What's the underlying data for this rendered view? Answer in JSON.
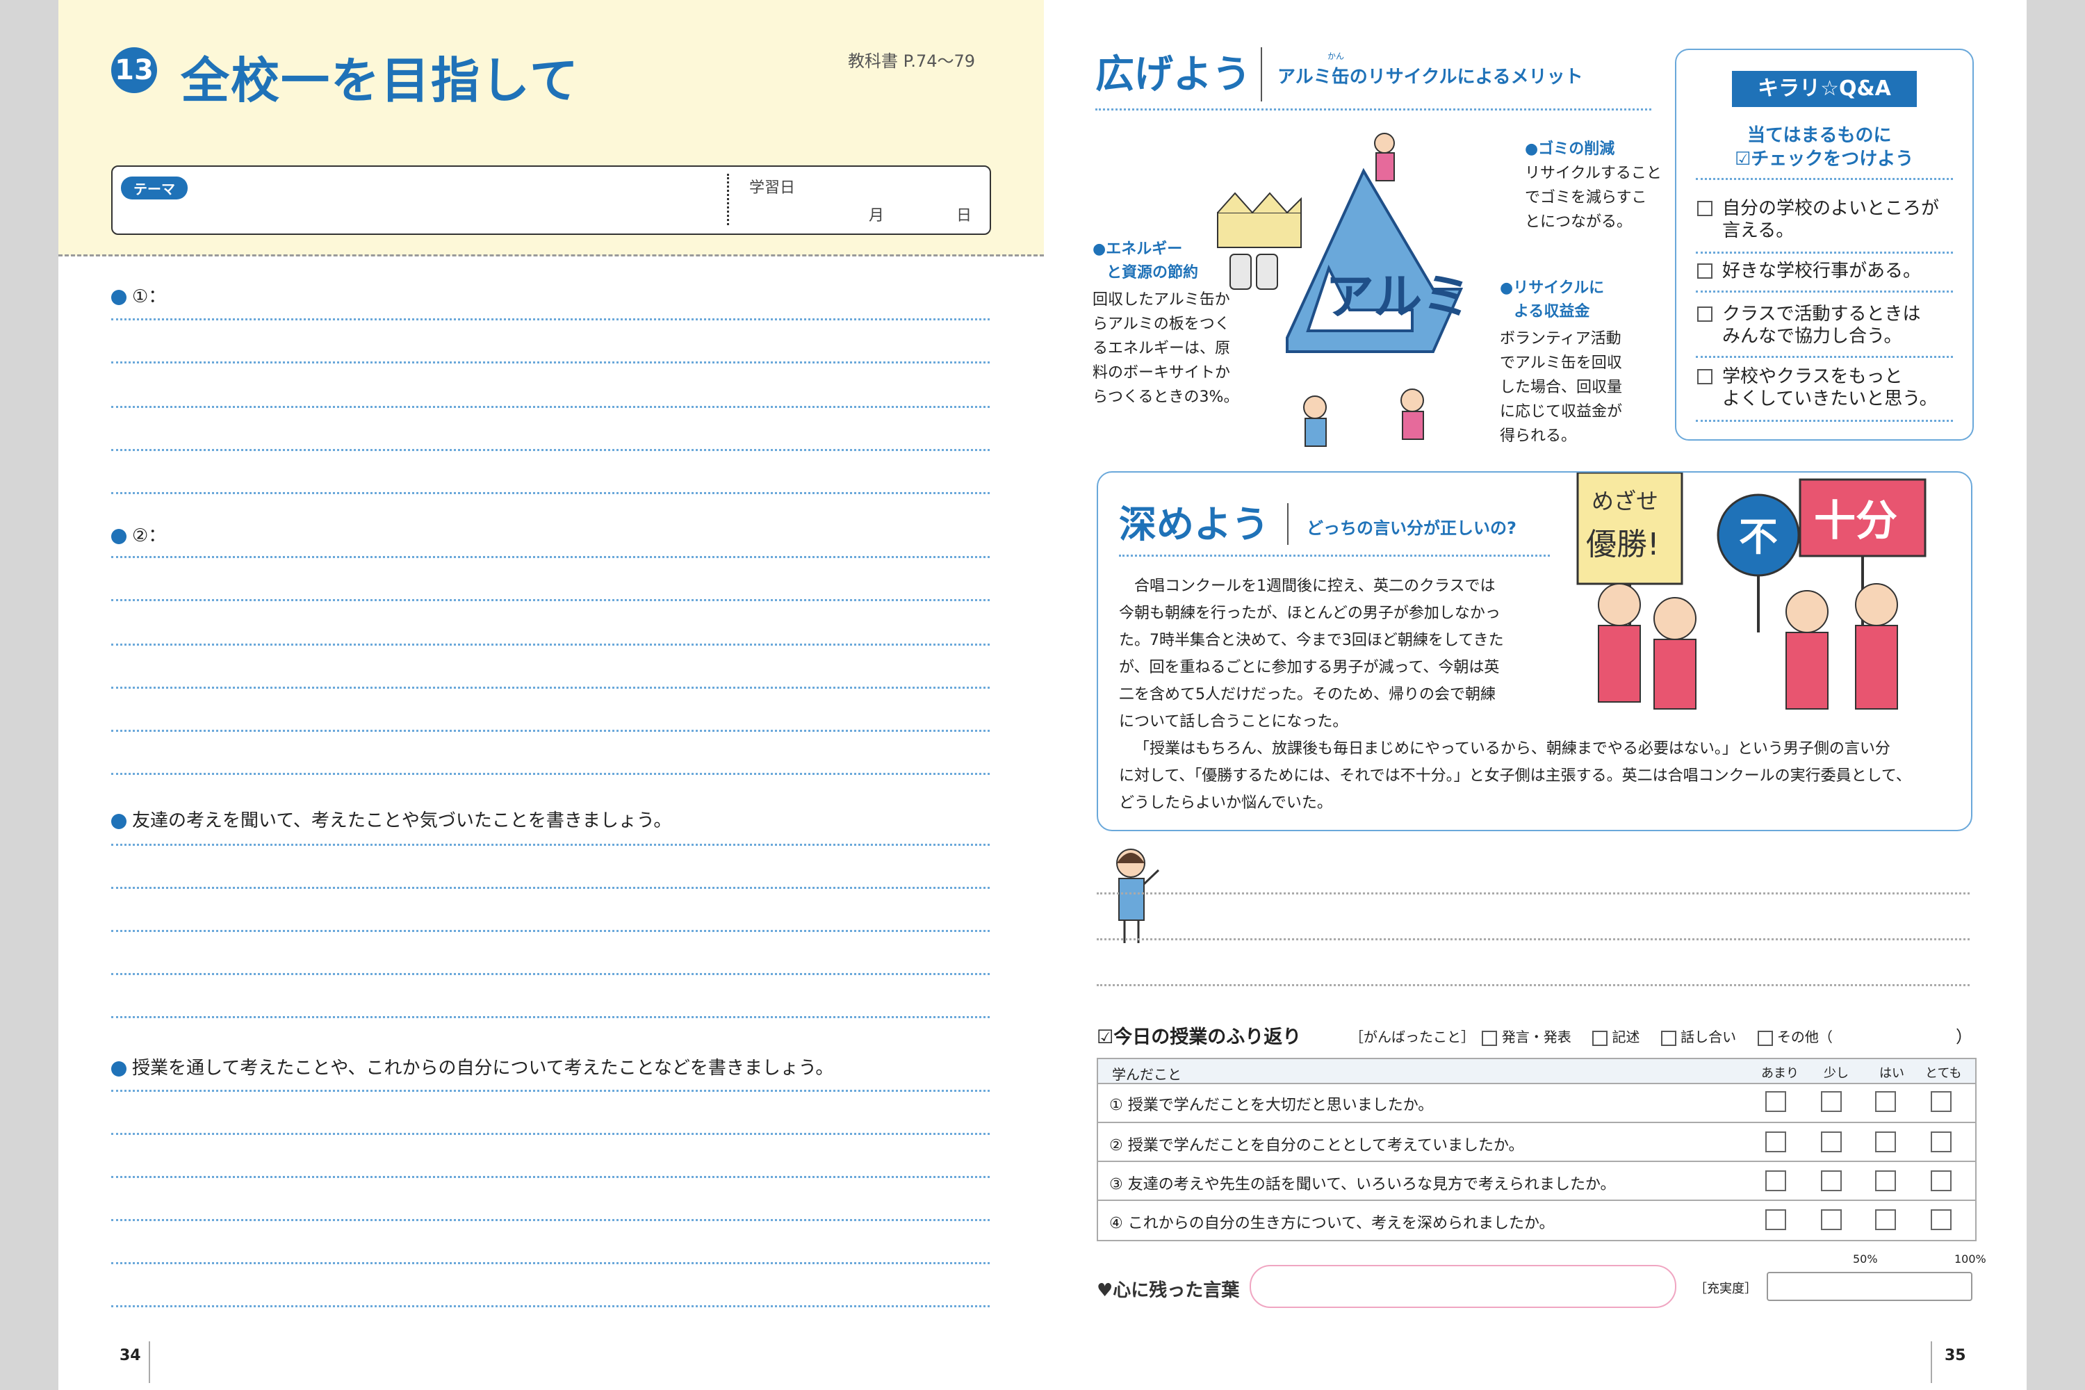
{
  "left": {
    "lesson_number": "13",
    "title": "全校一を目指して",
    "textbook_ref": "教科書 P.74～79",
    "theme_label": "テーマ",
    "study_date_label": "学習日",
    "month_label": "月",
    "day_label": "日",
    "prompt1": "①：",
    "prompt2": "②：",
    "prompt3": "友達の考えを聞いて、考えたことや気づいたことを書きましょう。",
    "prompt4": "授業を通して考えたことや、これからの自分について考えたことなどを書きましょう。",
    "page_number": "34"
  },
  "right": {
    "hirogeyou": {
      "heading": "広げよう",
      "subheading": "アルミ缶のリサイクルによるメリット",
      "furigana": "かん",
      "center_text": "アルミ",
      "item1_title": "●ゴミの削減",
      "item1_body": [
        "リサイクルすること",
        "でゴミを減らすこ",
        "とにつながる。"
      ],
      "item2_title": [
        "●エネルギー",
        "と資源の節約"
      ],
      "item2_body": [
        "回収したアルミ缶か",
        "らアルミの板をつく",
        "るエネルギーは、原",
        "料のボーキサイトか",
        "らつくるときの3%。"
      ],
      "item3_title": [
        "●リサイクルに",
        "よる収益金"
      ],
      "item3_body": [
        "ボランティア活動",
        "でアルミ缶を回収",
        "した場合、回収量",
        "に応じて収益金が",
        "得られる。"
      ]
    },
    "qa": {
      "title": "キラリ☆Q&A",
      "instruction1": "当てはまるものに",
      "instruction2": "☑チェックをつけよう",
      "items": [
        [
          "自分の学校のよいところが",
          "言える。"
        ],
        [
          "好きな学校行事がある。"
        ],
        [
          "クラスで活動するときは",
          "みんなで協力し合う。"
        ],
        [
          "学校やクラスをもっと",
          "よくしていきたいと思う。"
        ]
      ]
    },
    "fukameyou": {
      "heading": "深めよう",
      "subheading": "どっちの言い分が正しいの?",
      "sign1": "めざせ",
      "sign2": "優勝!",
      "sign3": "不",
      "sign4": "十分",
      "story_lines": [
        "合唱コンクールを1週間後に控え、英二のクラスでは",
        "今朝も朝練を行ったが、ほとんどの男子が参加しなかっ",
        "た。7時半集合と決めて、今まで3回ほど朝練をしてきた",
        "が、回を重ねるごとに参加する男子が減って、今朝は英",
        "二を含めて5人だけだった。そのため、帰りの会で朝練",
        "について話し合うことになった。"
      ],
      "story_wide": [
        "「授業はもちろん、放課後も毎日まじめにやっているから、朝練までやる必要はない。」という男子側の言い分",
        "に対して、「優勝するためには、それでは不十分。」と女子側は主張する。英二は合唱コンクールの実行委員として、",
        "どうしたらよいか悩んでいた。"
      ]
    },
    "review": {
      "title": "☑今日の授業のふり返り",
      "effort_label": "［がんばったこと］",
      "options": [
        "発言・発表",
        "記述",
        "話し合い",
        "その他（"
      ],
      "close_paren": "）",
      "table_header": "学んだこと",
      "scale": [
        "あまり",
        "少し",
        "はい",
        "とても"
      ],
      "questions": [
        "① 授業で学んだことを大切だと思いましたか。",
        "② 授業で学んだことを自分のこととして考えていましたか。",
        "③ 友達の考えや先生の話を聞いて、いろいろな見方で考えられましたか。",
        "④ これからの自分の生き方について、考えを深められましたか。"
      ],
      "words_label": "♥心に残った言葉",
      "satisfaction_label": "［充実度］",
      "mark50": "50%",
      "mark100": "100%"
    },
    "page_number": "35"
  },
  "colors": {
    "header_bg": "#fdf8d8",
    "accent_blue": "#1f72b8",
    "light_blue": "#6aa8da",
    "pink": "#e66a9b"
  }
}
